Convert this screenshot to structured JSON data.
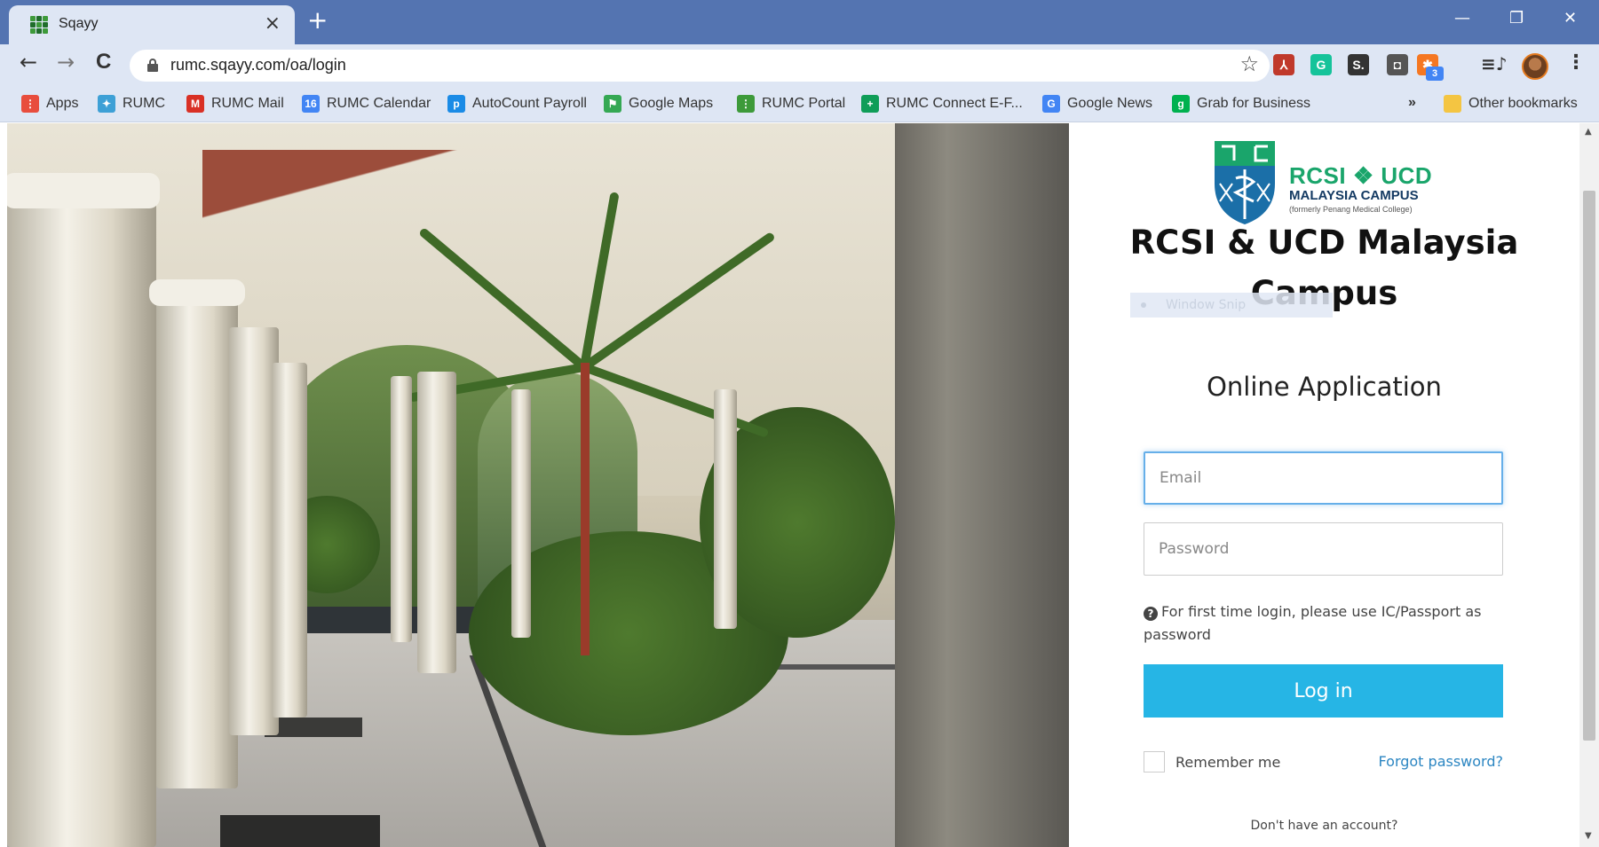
{
  "browser": {
    "tab_title": "Sqayy",
    "tab_close": "×",
    "new_tab": "+",
    "url": "rumc.sqayy.com/oa/login",
    "controls": {
      "minimize": "—",
      "restore": "❐",
      "close": "✕"
    },
    "nav": {
      "back": "←",
      "forward": "→",
      "reload": "C"
    },
    "extensions": [
      {
        "name": "acrobat-icon",
        "color": "#c0392b",
        "glyph": "⅄"
      },
      {
        "name": "grammarly-icon",
        "color": "#15c39a",
        "glyph": "G"
      },
      {
        "name": "sqayy-s-icon",
        "color": "#333333",
        "glyph": "S."
      },
      {
        "name": "extension-location-icon",
        "color": "#555555",
        "glyph": "◘"
      },
      {
        "name": "hubspot-icon",
        "color": "#f57722",
        "glyph": "✱"
      }
    ],
    "extension_badge": "3",
    "media_icon": "≡♪",
    "bookmarks": [
      {
        "label": "Apps",
        "icon": "apps-grid-icon",
        "color": "#e84d3d",
        "glyph": "⋮"
      },
      {
        "label": "RUMC",
        "icon": "rumc-logo-icon",
        "color": "#3da0d6",
        "glyph": "✦"
      },
      {
        "label": "RUMC Mail",
        "icon": "gmail-icon",
        "color": "#d93025",
        "glyph": "M"
      },
      {
        "label": "RUMC Calendar",
        "icon": "calendar-icon",
        "color": "#4285f4",
        "glyph": "16"
      },
      {
        "label": "AutoCount Payroll",
        "icon": "autocount-icon",
        "color": "#1a8be6",
        "glyph": "p"
      },
      {
        "label": "Google Maps",
        "icon": "maps-icon",
        "color": "#34a853",
        "glyph": "⚑"
      },
      {
        "label": "RUMC Portal",
        "icon": "sqayy-portal-icon",
        "color": "#3d9a3a",
        "glyph": "⋮"
      },
      {
        "label": "RUMC Connect E-F...",
        "icon": "connect-icon",
        "color": "#0f9d58",
        "glyph": "+"
      },
      {
        "label": "Google News",
        "icon": "news-icon",
        "color": "#4285f4",
        "glyph": "G"
      },
      {
        "label": "Grab for Business",
        "icon": "grab-icon",
        "color": "#00b14f",
        "glyph": "g"
      }
    ],
    "bookmarks_overflow": "»",
    "other_bookmarks": "Other bookmarks"
  },
  "logo": {
    "title": "RCSI ❖ UCD",
    "subtitle": "MALAYSIA CAMPUS",
    "note": "(formerly Penang Medical College)",
    "green": "#1aa56b",
    "navy": "#143a63"
  },
  "login": {
    "heading": "RCSI & UCD Malaysia Campus",
    "subheading": "Online Application",
    "email_placeholder": "Email",
    "password_placeholder": "Password",
    "hint_icon": "?",
    "hint": "For first time login, please use IC/Passport as password",
    "button": "Log in",
    "button_color": "#26b5e5",
    "remember": "Remember me",
    "forgot": "Forgot password?",
    "signup": "Don't have an account?"
  },
  "overlay": {
    "snip_label": "Window Snip"
  },
  "scrollbar": {
    "up": "▲",
    "down": "▼"
  }
}
